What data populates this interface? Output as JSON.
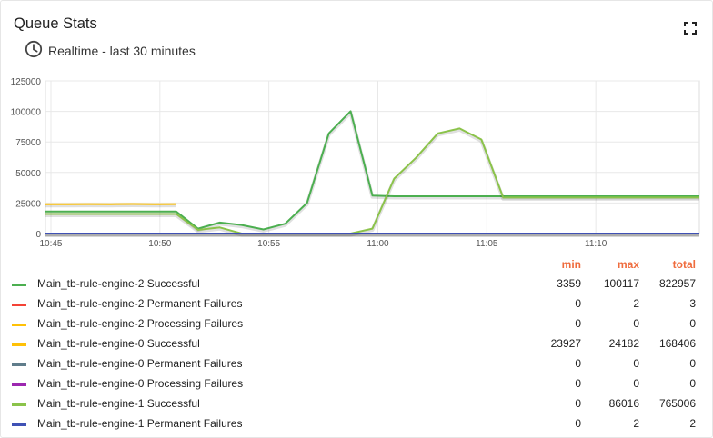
{
  "widget": {
    "title": "Queue Stats",
    "subtitle": "Realtime - last 30 minutes"
  },
  "icons": {
    "clock": "clock-icon",
    "fullscreen": "fullscreen-icon"
  },
  "legend": {
    "headers": {
      "min": "min",
      "max": "max",
      "total": "total"
    },
    "rows": [
      {
        "label": "Main_tb-rule-engine-2 Successful",
        "color": "#4caf50",
        "min": "3359",
        "max": "100117",
        "total": "822957"
      },
      {
        "label": "Main_tb-rule-engine-2 Permanent Failures",
        "color": "#f44336",
        "min": "0",
        "max": "2",
        "total": "3"
      },
      {
        "label": "Main_tb-rule-engine-2 Processing Failures",
        "color": "#ffc107",
        "min": "0",
        "max": "0",
        "total": "0"
      },
      {
        "label": "Main_tb-rule-engine-0 Successful",
        "color": "#ffc107",
        "min": "23927",
        "max": "24182",
        "total": "168406"
      },
      {
        "label": "Main_tb-rule-engine-0 Permanent Failures",
        "color": "#607d8b",
        "min": "0",
        "max": "0",
        "total": "0"
      },
      {
        "label": "Main_tb-rule-engine-0 Processing Failures",
        "color": "#9c27b0",
        "min": "0",
        "max": "0",
        "total": "0"
      },
      {
        "label": "Main_tb-rule-engine-1 Successful",
        "color": "#8bc34a",
        "min": "0",
        "max": "86016",
        "total": "765006"
      },
      {
        "label": "Main_tb-rule-engine-1 Permanent Failures",
        "color": "#3f51b5",
        "min": "0",
        "max": "2",
        "total": "2"
      }
    ]
  },
  "chart_data": {
    "type": "line",
    "ylim": [
      0,
      125000
    ],
    "yticks": [
      0,
      25000,
      50000,
      75000,
      100000,
      125000
    ],
    "ytick_labels": [
      "0",
      "25000",
      "50000",
      "75000",
      "100000",
      "125000"
    ],
    "xlim": [
      "10:44:45",
      "11:14:45"
    ],
    "xticks": [
      "10:45",
      "10:50",
      "10:55",
      "11:00",
      "11:05",
      "11:10"
    ],
    "grid": true,
    "series": [
      {
        "name": "Main_tb-rule-engine-2 Successful",
        "color": "#4caf50",
        "x": [
          "10:44:45",
          "10:45:45",
          "10:46:45",
          "10:47:45",
          "10:48:45",
          "10:49:45",
          "10:50:45",
          "10:51:45",
          "10:52:45",
          "10:53:45",
          "10:54:45",
          "10:55:45",
          "10:56:45",
          "10:57:45",
          "10:58:45",
          "10:59:45",
          "11:00:45",
          "11:01:45",
          "11:02:45",
          "11:03:45",
          "11:04:45",
          "11:05:45",
          "11:06:45",
          "11:07:45",
          "11:08:45",
          "11:09:45",
          "11:10:45",
          "11:11:45",
          "11:12:45",
          "11:13:45",
          "11:14:45"
        ],
        "values": [
          18000,
          18000,
          18000,
          18000,
          18000,
          18000,
          18000,
          4000,
          9000,
          7000,
          3359,
          8000,
          25000,
          82000,
          100117,
          31000,
          30500,
          30500,
          30500,
          30500,
          30500,
          30500,
          30500,
          30500,
          30500,
          30500,
          30500,
          30500,
          30500,
          30500,
          30500
        ]
      },
      {
        "name": "Main_tb-rule-engine-0 Successful",
        "color": "#ffc107",
        "x": [
          "10:44:45",
          "10:45:45",
          "10:46:45",
          "10:47:45",
          "10:48:45",
          "10:49:45",
          "10:50:45"
        ],
        "values": [
          24000,
          23927,
          24100,
          24000,
          24182,
          24000,
          24100
        ]
      },
      {
        "name": "Main_tb-rule-engine-1 Successful",
        "color": "#8bc34a",
        "x": [
          "10:44:45",
          "10:45:45",
          "10:46:45",
          "10:47:45",
          "10:48:45",
          "10:49:45",
          "10:50:45",
          "10:51:45",
          "10:52:45",
          "10:53:45",
          "10:54:45",
          "10:55:45",
          "10:56:45",
          "10:57:45",
          "10:58:45",
          "10:59:45",
          "11:00:45",
          "11:01:45",
          "11:02:45",
          "11:03:45",
          "11:04:45",
          "11:05:45",
          "11:06:45",
          "11:07:45",
          "11:08:45",
          "11:09:45",
          "11:10:45",
          "11:11:45",
          "11:12:45",
          "11:13:45",
          "11:14:45"
        ],
        "values": [
          16000,
          16000,
          16000,
          16000,
          16000,
          16000,
          16000,
          3000,
          5000,
          0,
          0,
          0,
          0,
          0,
          0,
          4000,
          45000,
          62000,
          82000,
          86016,
          77000,
          29500,
          29500,
          29500,
          29500,
          29500,
          29500,
          29500,
          29500,
          29500,
          29500
        ]
      },
      {
        "name": "Main_tb-rule-engine-2 Permanent Failures",
        "color": "#f44336",
        "x": [
          "10:44:45",
          "11:14:45"
        ],
        "values": [
          0,
          0
        ]
      },
      {
        "name": "Main_tb-rule-engine-0 Processing Failures",
        "color": "#9c27b0",
        "x": [
          "10:44:45",
          "11:14:45"
        ],
        "values": [
          0,
          0
        ]
      },
      {
        "name": "Main_tb-rule-engine-1 Permanent Failures",
        "color": "#3f51b5",
        "x": [
          "10:44:45",
          "11:14:45"
        ],
        "values": [
          0,
          0
        ]
      }
    ]
  }
}
